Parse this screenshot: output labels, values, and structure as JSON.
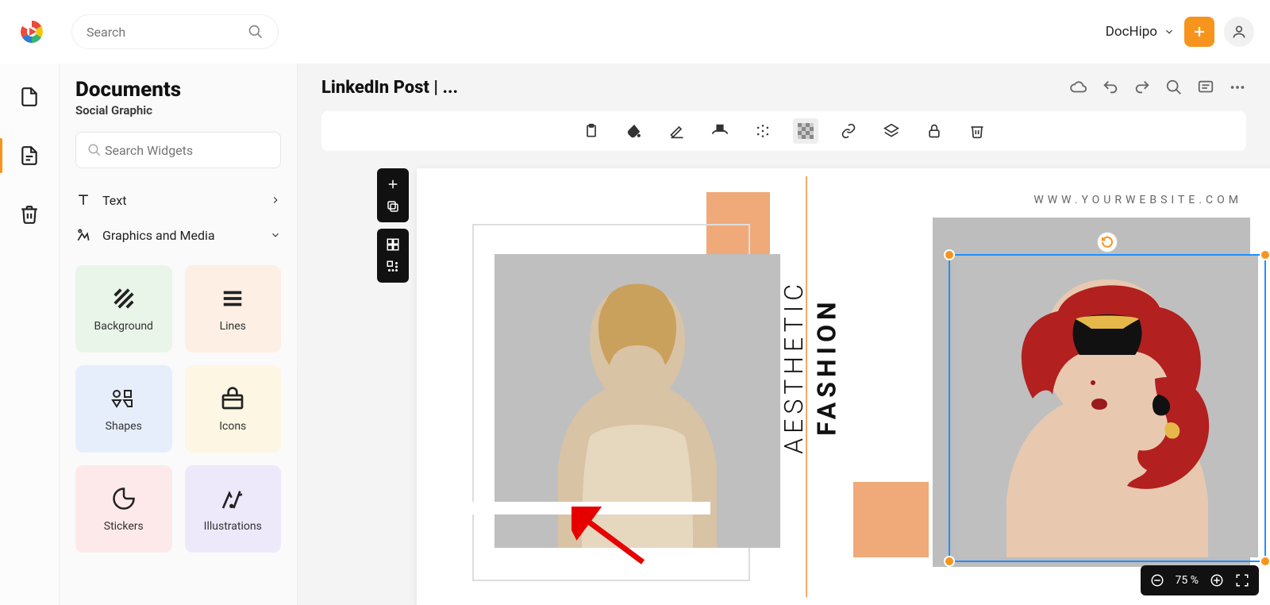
{
  "topbar": {
    "search_placeholder": "Search",
    "workspace_label": "DocHipo"
  },
  "sidebar": {
    "title": "Documents",
    "subtitle": "Social Graphic",
    "widget_search_placeholder": "Search Widgets",
    "category_text": "Text",
    "category_media": "Graphics and Media",
    "tiles": {
      "background": "Background",
      "lines": "Lines",
      "shapes": "Shapes",
      "icons": "Icons",
      "stickers": "Stickers",
      "illustrations": "Illustrations"
    }
  },
  "document": {
    "title": "LinkedIn Post | ..."
  },
  "artboard": {
    "url": "WWW.YOURWEBSITE.COM",
    "vertical_line1": "AESTHETIC",
    "vertical_line2": "FASHION"
  },
  "zoom": {
    "level": "75 %"
  }
}
